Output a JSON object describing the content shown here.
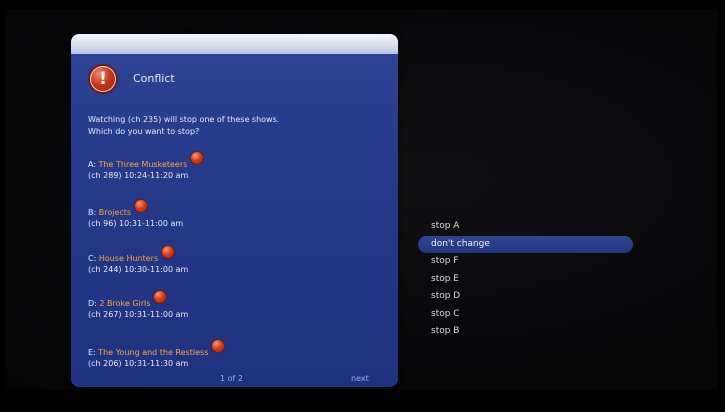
{
  "dialog": {
    "title": "Conflict",
    "message_line1": "Watching (ch 235) will stop one of these shows.",
    "message_line2": "Which do you want to stop?",
    "shows": [
      {
        "letter": "A:",
        "name": "The Three Musketeers",
        "details": "(ch 289) 10:24-11:20 am"
      },
      {
        "letter": "B:",
        "name": "Brojects",
        "details": "(ch 96) 10:31-11:00 am"
      },
      {
        "letter": "C:",
        "name": "House Hunters",
        "details": "(ch 244) 10:30-11:00 am"
      },
      {
        "letter": "D:",
        "name": "2 Broke Girls",
        "details": "(ch 267) 10:31-11:00 am"
      },
      {
        "letter": "E:",
        "name": "The Young and the Restless",
        "details": "(ch 206) 10:31-11:30 am"
      }
    ],
    "pager": "1 of 2",
    "next_label": "next"
  },
  "menu": {
    "items": [
      {
        "label": "stop A"
      },
      {
        "label": "don't change"
      },
      {
        "label": "stop F"
      },
      {
        "label": "stop E"
      },
      {
        "label": "stop D"
      },
      {
        "label": "stop C"
      },
      {
        "label": "stop B"
      }
    ],
    "selected_label": "don't change"
  },
  "colors": {
    "dialog_bg": "#26398a",
    "show_name": "#f0a64a",
    "selection_bg": "#2f4595"
  },
  "icons": {
    "alert": "exclamation-alert-icon",
    "record": "record-dot-icon"
  }
}
